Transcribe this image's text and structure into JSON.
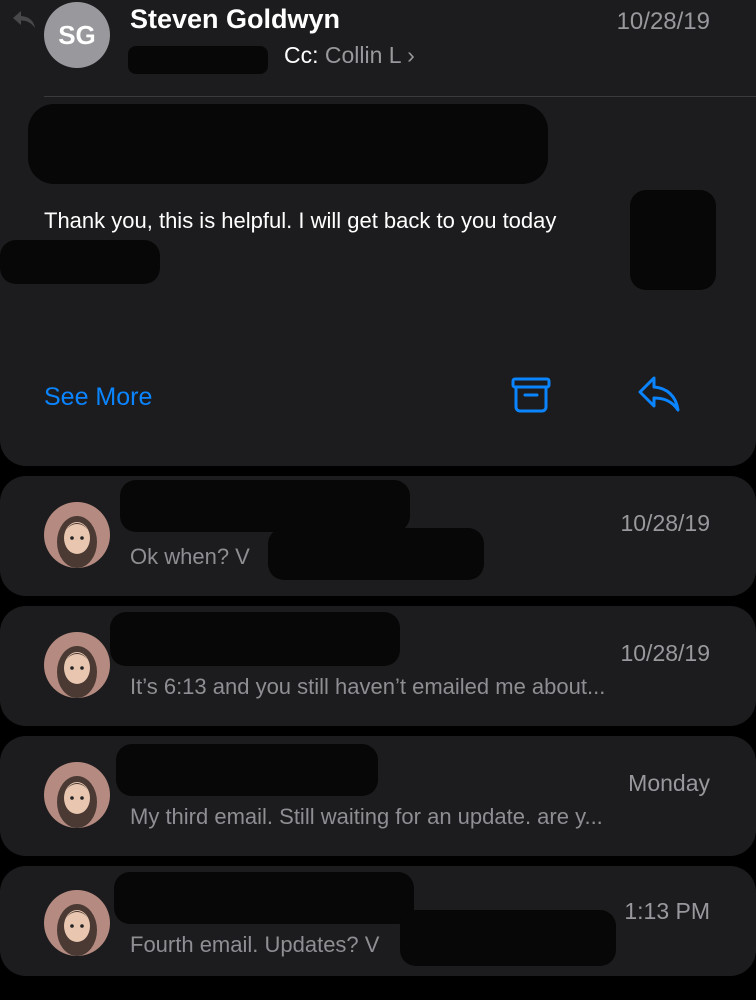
{
  "message": {
    "sender_initials": "SG",
    "sender": "Steven Goldwyn",
    "date": "10/28/19",
    "cc_label": "Cc:",
    "cc_name": "Collin L",
    "cc_chevron": "›",
    "body": "Thank you, this is helpful.  I will get back to you today",
    "see_more": "See More",
    "icons": {
      "back": "reply-arrow-icon",
      "archive": "archive-box-icon",
      "reply": "reply-arrow-icon"
    }
  },
  "thread": [
    {
      "date": "10/28/19",
      "preview": "Ok when? V"
    },
    {
      "date": "10/28/19",
      "preview": "It’s 6:13 and you still haven’t emailed me about..."
    },
    {
      "date": "Monday",
      "preview": "My third email. Still waiting for an update. are y..."
    },
    {
      "date": "1:13 PM",
      "preview": "Fourth email. Updates? V"
    }
  ],
  "colors": {
    "background": "#000000",
    "card": "#1c1c1e",
    "accent": "#0a84ff",
    "secondary_text": "#98989d",
    "avatar_bg": "#b58a80"
  }
}
